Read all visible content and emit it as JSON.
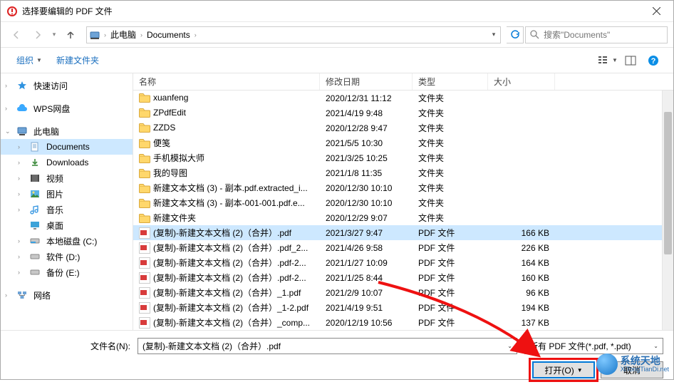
{
  "window": {
    "title": "选择要编辑的 PDF 文件"
  },
  "breadcrumb": {
    "segments": [
      "此电脑",
      "Documents"
    ]
  },
  "search": {
    "placeholder": "搜索\"Documents\""
  },
  "toolbar": {
    "organize": "组织",
    "new_folder": "新建文件夹"
  },
  "sidebar": {
    "quick_access": "快速访问",
    "wps_cloud": "WPS网盘",
    "this_pc": "此电脑",
    "documents": "Documents",
    "downloads": "Downloads",
    "videos": "视频",
    "pictures": "图片",
    "music": "音乐",
    "desktop": "桌面",
    "drive_c": "本地磁盘 (C:)",
    "drive_d": "软件 (D:)",
    "drive_e": "备份 (E:)",
    "network": "网络"
  },
  "columns": {
    "name": "名称",
    "date": "修改日期",
    "type": "类型",
    "size": "大小"
  },
  "rows": [
    {
      "icon": "folder",
      "name": "xuanfeng",
      "date": "2020/12/31 11:12",
      "type": "文件夹",
      "size": ""
    },
    {
      "icon": "folder",
      "name": "ZPdfEdit",
      "date": "2021/4/19 9:48",
      "type": "文件夹",
      "size": ""
    },
    {
      "icon": "folder",
      "name": "ZZDS",
      "date": "2020/12/28 9:47",
      "type": "文件夹",
      "size": ""
    },
    {
      "icon": "folder",
      "name": "便笺",
      "date": "2021/5/5 10:30",
      "type": "文件夹",
      "size": ""
    },
    {
      "icon": "folder",
      "name": "手机模拟大师",
      "date": "2021/3/25 10:25",
      "type": "文件夹",
      "size": ""
    },
    {
      "icon": "folder",
      "name": "我的导图",
      "date": "2021/1/8 11:35",
      "type": "文件夹",
      "size": ""
    },
    {
      "icon": "folder",
      "name": "新建文本文档 (3) - 副本.pdf.extracted_i...",
      "date": "2020/12/30 10:10",
      "type": "文件夹",
      "size": ""
    },
    {
      "icon": "folder",
      "name": "新建文本文档 (3) - 副本-001-001.pdf.e...",
      "date": "2020/12/30 10:10",
      "type": "文件夹",
      "size": ""
    },
    {
      "icon": "folder",
      "name": "新建文件夹",
      "date": "2020/12/29 9:07",
      "type": "文件夹",
      "size": ""
    },
    {
      "icon": "pdf",
      "name": "(复制)-新建文本文档 (2)（合并）.pdf",
      "date": "2021/3/27 9:47",
      "type": "PDF 文件",
      "size": "166 KB",
      "selected": true
    },
    {
      "icon": "pdf",
      "name": "(复制)-新建文本文档 (2)（合并）.pdf_2...",
      "date": "2021/4/26 9:58",
      "type": "PDF 文件",
      "size": "226 KB"
    },
    {
      "icon": "pdf",
      "name": "(复制)-新建文本文档 (2)（合并）.pdf-2...",
      "date": "2021/1/27 10:09",
      "type": "PDF 文件",
      "size": "164 KB"
    },
    {
      "icon": "pdf",
      "name": "(复制)-新建文本文档 (2)（合并）.pdf-2...",
      "date": "2021/1/25 8:44",
      "type": "PDF 文件",
      "size": "160 KB"
    },
    {
      "icon": "pdf",
      "name": "(复制)-新建文本文档 (2)（合并）_1.pdf",
      "date": "2021/2/9 10:07",
      "type": "PDF 文件",
      "size": "96 KB"
    },
    {
      "icon": "pdf",
      "name": "(复制)-新建文本文档 (2)（合并）_1-2.pdf",
      "date": "2021/4/19 9:51",
      "type": "PDF 文件",
      "size": "194 KB"
    },
    {
      "icon": "pdf",
      "name": "(复制)-新建文本文档 (2)（合并）_comp...",
      "date": "2020/12/19 10:56",
      "type": "PDF 文件",
      "size": "137 KB"
    }
  ],
  "footer": {
    "filename_label": "文件名(N):",
    "filename_value": "(复制)-新建文本文档 (2)（合并）.pdf",
    "filetype_value": "所有 PDF 文件(*.pdf, *.pdt)",
    "open_btn": "打开(O)",
    "cancel_btn": "取消"
  },
  "watermark": {
    "cn": "系统天地",
    "en": "XiTongTianDi.net"
  }
}
